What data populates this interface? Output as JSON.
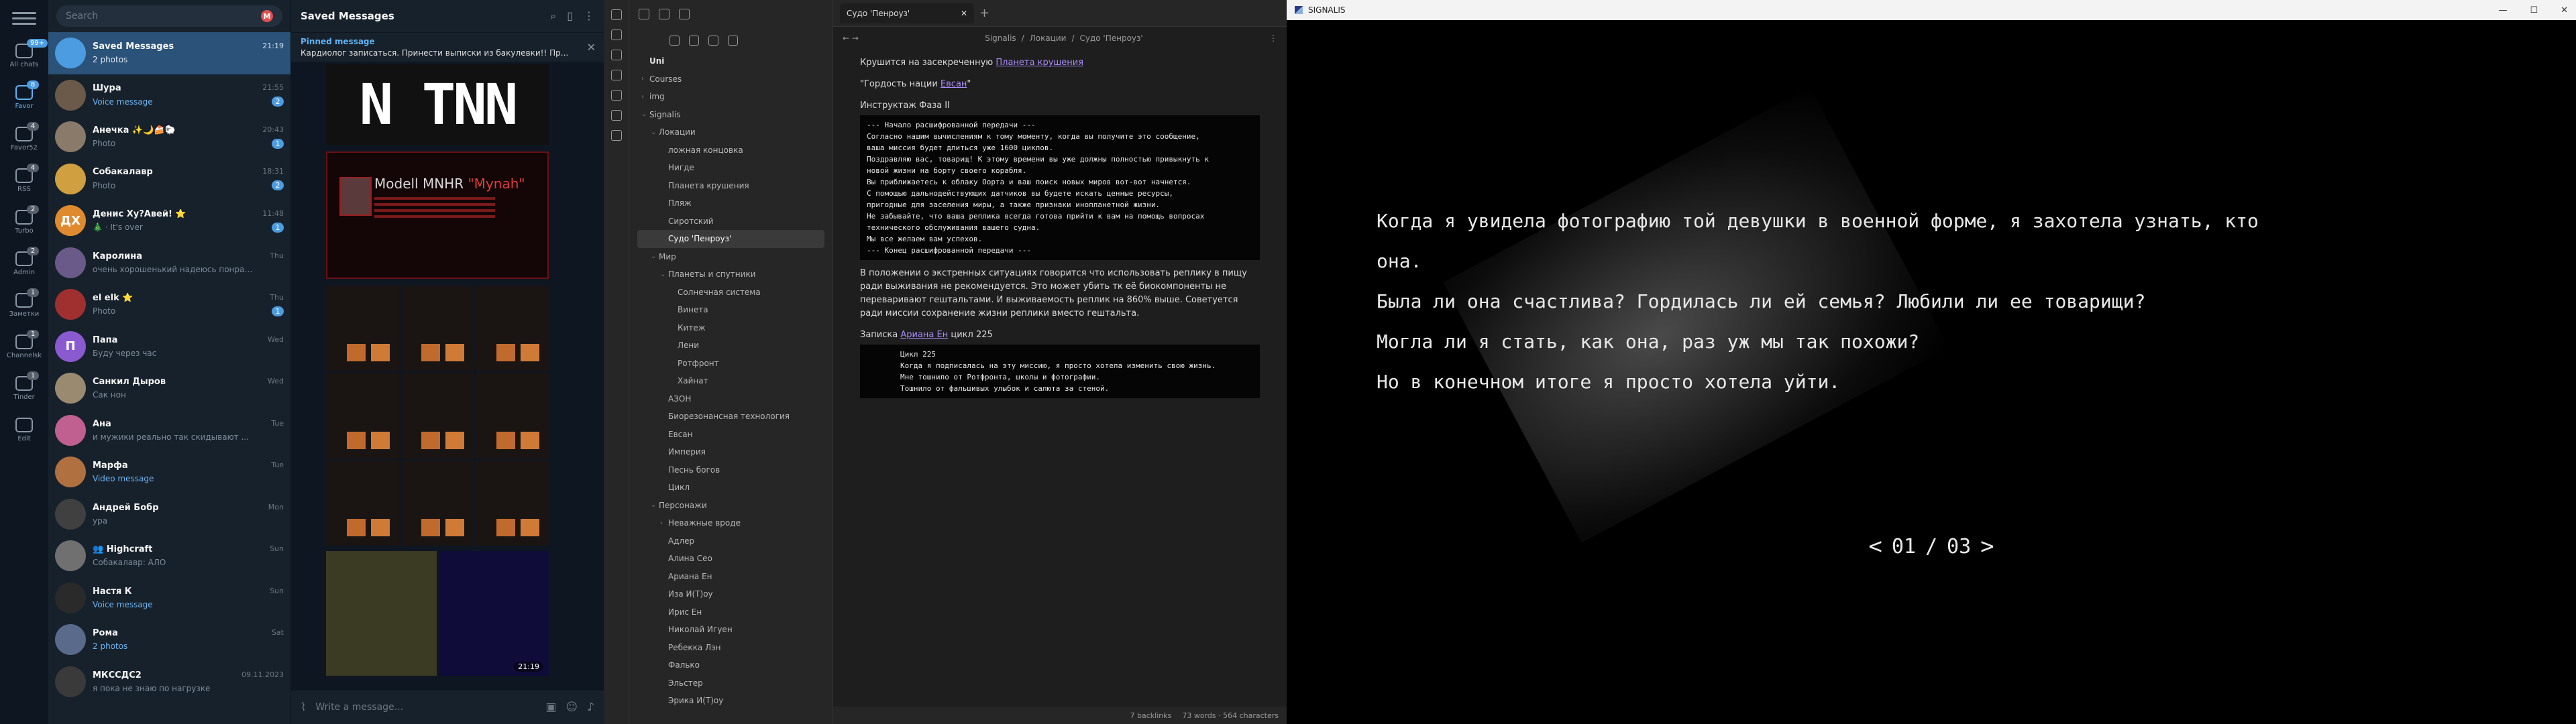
{
  "telegram": {
    "folders": [
      {
        "name": "All chats",
        "badge": "99+",
        "active": false,
        "muted": false
      },
      {
        "name": "Favor",
        "badge": "8",
        "active": true,
        "muted": false
      },
      {
        "name": "Favor52",
        "badge": "4",
        "active": false,
        "muted": true
      },
      {
        "name": "RSS",
        "badge": "4",
        "active": false,
        "muted": true
      },
      {
        "name": "Turbo",
        "badge": "2",
        "active": false,
        "muted": true
      },
      {
        "name": "Admin",
        "badge": "2",
        "active": false,
        "muted": true
      },
      {
        "name": "Заметки",
        "badge": "1",
        "active": false,
        "muted": true
      },
      {
        "name": "Channelsk",
        "badge": "1",
        "active": false,
        "muted": true
      },
      {
        "name": "Tinder",
        "badge": "1",
        "active": false,
        "muted": true
      },
      {
        "name": "Edit",
        "badge": "",
        "active": false,
        "muted": false
      }
    ],
    "search_placeholder": "Search",
    "chats": [
      {
        "name": "Saved Messages",
        "time": "21:19",
        "msg": "2 photos",
        "badge": "",
        "color": "#4c9ce2",
        "initials": "",
        "active": true,
        "hl": false
      },
      {
        "name": "Шура",
        "time": "21:55",
        "msg": "Voice message",
        "badge": "2",
        "color": "#6b5a4a",
        "initials": "",
        "active": false,
        "hl": true
      },
      {
        "name": "Анечка ✨🌙🍰🐑",
        "time": "20:43",
        "msg": "Photo",
        "badge": "1",
        "color": "#8a7a6a",
        "initials": "",
        "active": false,
        "hl": false
      },
      {
        "name": "Собакалавр",
        "time": "18:31",
        "msg": "Photo",
        "badge": "2",
        "color": "#d0a040",
        "initials": "",
        "active": false,
        "hl": false
      },
      {
        "name": "Денис Ху?Авей! ⭐",
        "time": "11:48",
        "msg": "🎄 · It's over",
        "badge": "1",
        "color": "#e08a30",
        "initials": "ДХ",
        "active": false,
        "hl": false
      },
      {
        "name": "Каролина",
        "time": "Thu",
        "msg": "очень хорошенький надеюсь понрави...",
        "badge": "",
        "color": "#6a5a8a",
        "initials": "",
        "active": false,
        "hl": false
      },
      {
        "name": "el elk ⭐",
        "time": "Thu",
        "msg": "Photo",
        "badge": "1",
        "color": "#a03030",
        "initials": "",
        "active": false,
        "hl": false
      },
      {
        "name": "Папа",
        "time": "Wed",
        "msg": "Буду через час",
        "badge": "",
        "color": "#8a5ad0",
        "initials": "П",
        "active": false,
        "hl": false
      },
      {
        "name": "Санкил Дыров",
        "time": "Wed",
        "msg": "Сак нон",
        "badge": "",
        "color": "#9a8a70",
        "initials": "",
        "active": false,
        "hl": false
      },
      {
        "name": "Ана",
        "time": "Tue",
        "msg": "и мужики реально так скидывают ...",
        "badge": "",
        "color": "#c06090",
        "initials": "",
        "active": false,
        "hl": false
      },
      {
        "name": "Марфа",
        "time": "Tue",
        "msg": "Video message",
        "badge": "",
        "color": "#b07040",
        "initials": "",
        "active": false,
        "hl": true
      },
      {
        "name": "Андрей Бобр",
        "time": "Mon",
        "msg": "ура",
        "badge": "",
        "color": "#404040",
        "initials": "",
        "active": false,
        "hl": false
      },
      {
        "name": "👥 Highcraft",
        "time": "Sun",
        "msg": "Собакалавр: АЛО",
        "badge": "",
        "color": "#707070",
        "initials": "",
        "active": false,
        "hl": false
      },
      {
        "name": "Настя К",
        "time": "Sun",
        "msg": "Voice message",
        "badge": "",
        "color": "#2a2a2a",
        "initials": "",
        "active": false,
        "hl": true
      },
      {
        "name": "Рома",
        "time": "Sat",
        "msg": "2 photos",
        "badge": "",
        "color": "#5a6a8a",
        "initials": "",
        "active": false,
        "hl": true
      },
      {
        "name": "МКССДС2",
        "time": "09.11.2023",
        "msg": "я пока не знаю по нагрузке",
        "badge": "",
        "color": "#3a3a3a",
        "initials": "",
        "active": false,
        "hl": false
      }
    ],
    "chat_title": "Saved Messages",
    "pinned_label": "Pinned message",
    "pinned_text": "Кардиолог записаться. Принести выписки из бакулевки!! Пр...",
    "media_big": "N TNN",
    "media_poster_title": "Modell MNHR",
    "media_poster_quote": "\"Mynah\"",
    "media_time": "21:19",
    "composer_placeholder": "Write a message..."
  },
  "obsidian": {
    "tab_title": "Судо 'Пенроуз'",
    "crumbs": [
      "Signalis",
      "Локации",
      "Судо 'Пенроуз'"
    ],
    "tree": [
      {
        "label": "Uni",
        "depth": 0,
        "chev": "",
        "root": true,
        "sel": false
      },
      {
        "label": "Courses",
        "depth": 0,
        "chev": "›",
        "root": false,
        "sel": false
      },
      {
        "label": "img",
        "depth": 0,
        "chev": "›",
        "root": false,
        "sel": false
      },
      {
        "label": "Signalis",
        "depth": 0,
        "chev": "⌄",
        "root": false,
        "sel": false
      },
      {
        "label": "Локации",
        "depth": 1,
        "chev": "⌄",
        "root": false,
        "sel": false
      },
      {
        "label": "ложная концовка",
        "depth": 2,
        "chev": "",
        "root": false,
        "sel": false
      },
      {
        "label": "Нигде",
        "depth": 2,
        "chev": "",
        "root": false,
        "sel": false
      },
      {
        "label": "Планета крушения",
        "depth": 2,
        "chev": "",
        "root": false,
        "sel": false
      },
      {
        "label": "Пляж",
        "depth": 2,
        "chev": "",
        "root": false,
        "sel": false
      },
      {
        "label": "Сиротский",
        "depth": 2,
        "chev": "",
        "root": false,
        "sel": false
      },
      {
        "label": "Судо 'Пенроуз'",
        "depth": 2,
        "chev": "",
        "root": false,
        "sel": true
      },
      {
        "label": "Мир",
        "depth": 1,
        "chev": "⌄",
        "root": false,
        "sel": false
      },
      {
        "label": "Планеты и спутники",
        "depth": 2,
        "chev": "⌄",
        "root": false,
        "sel": false
      },
      {
        "label": "Солнечная система",
        "depth": 3,
        "chev": "",
        "root": false,
        "sel": false
      },
      {
        "label": "Винета",
        "depth": 3,
        "chev": "",
        "root": false,
        "sel": false
      },
      {
        "label": "Китеж",
        "depth": 3,
        "chev": "",
        "root": false,
        "sel": false
      },
      {
        "label": "Лени",
        "depth": 3,
        "chev": "",
        "root": false,
        "sel": false
      },
      {
        "label": "Ротфронт",
        "depth": 3,
        "chev": "",
        "root": false,
        "sel": false
      },
      {
        "label": "Хайнат",
        "depth": 3,
        "chev": "",
        "root": false,
        "sel": false
      },
      {
        "label": "АЗОН",
        "depth": 2,
        "chev": "",
        "root": false,
        "sel": false
      },
      {
        "label": "Биорезонансная технология",
        "depth": 2,
        "chev": "",
        "root": false,
        "sel": false
      },
      {
        "label": "Евсан",
        "depth": 2,
        "chev": "",
        "root": false,
        "sel": false
      },
      {
        "label": "Империя",
        "depth": 2,
        "chev": "",
        "root": false,
        "sel": false
      },
      {
        "label": "Песнь богов",
        "depth": 2,
        "chev": "",
        "root": false,
        "sel": false
      },
      {
        "label": "Цикл",
        "depth": 2,
        "chev": "",
        "root": false,
        "sel": false
      },
      {
        "label": "Персонажи",
        "depth": 1,
        "chev": "⌄",
        "root": false,
        "sel": false
      },
      {
        "label": "Неважные вроде",
        "depth": 2,
        "chev": "›",
        "root": false,
        "sel": false
      },
      {
        "label": "Адлер",
        "depth": 2,
        "chev": "",
        "root": false,
        "sel": false
      },
      {
        "label": "Алина Сео",
        "depth": 2,
        "chev": "",
        "root": false,
        "sel": false
      },
      {
        "label": "Ариана Ен",
        "depth": 2,
        "chev": "",
        "root": false,
        "sel": false
      },
      {
        "label": "Изa И(Т)оу",
        "depth": 2,
        "chev": "",
        "root": false,
        "sel": false
      },
      {
        "label": "Ирис Ен",
        "depth": 2,
        "chev": "",
        "root": false,
        "sel": false
      },
      {
        "label": "Николай Игуен",
        "depth": 2,
        "chev": "",
        "root": false,
        "sel": false
      },
      {
        "label": "Ребекка Лэн",
        "depth": 2,
        "chev": "",
        "root": false,
        "sel": false
      },
      {
        "label": "Фалько",
        "depth": 2,
        "chev": "",
        "root": false,
        "sel": false
      },
      {
        "label": "Эльстер",
        "depth": 2,
        "chev": "",
        "root": false,
        "sel": false
      },
      {
        "label": "Эрика И(Т)оу",
        "depth": 2,
        "chev": "",
        "root": false,
        "sel": false
      }
    ],
    "note": {
      "p1_pre": "Крушится на засекреченную ",
      "p1_link": "Планета крушения",
      "p2_pre": "\"Гордость нации ",
      "p2_link": "Евсан",
      "p2_post": "\"",
      "p3": "Инструктаж Фаза II",
      "term1": [
        "--- Начало расшифрованной передачи ---",
        "Согласно нашим вычислениям к тому моменту, когда вы получите это сообщение,",
        "ваша миссия будет длиться уже 1600 циклов.",
        "Поздравляю вас, товарищ! К этому времени вы уже должны полностью привыкнуть к",
        "новой жизни на борту своего корабля.",
        "Вы приближаетесь к облаку Oopта и ваш поиск новых миров вот-вот начнется.",
        "С помощью дальнодействующих датчиков вы будете искать ценные ресурсы,",
        "пригодные для заселения миры, а также признаки инопланетной жизни.",
        "Не забывайте, что ваша реплика всегда готова прийти к вам на помощь вопросах",
        "технического обслуживания вашего судна.",
        "Мы все желаем вам успехов.",
        "--- Конец расшифрованной передачи ---"
      ],
      "p4": "В положении о экстренных ситуациях говорится что использовать реплику в пищу ради выживания не рекомендуется. Это может убить тк её биокомпоненты не переваривают гештальтами. И выживаемость реплик на 860% выше. Советуется ради миссии сохранение жизни реплики вместо гештальта.",
      "p5_pre": "Записка ",
      "p5_link": "Ариана Ен",
      "p5_post": " цикл 225",
      "term2": [
        "Цикл 225",
        "Когда я подписалась на эту миссию, я просто хотела изменить свою жизнь.",
        "Мне тошнило от Ротфронта, школы и фотографии.",
        "Тошнило от фальшивых улыбок и салюта за стеной."
      ]
    },
    "status_backlinks": "7 backlinks",
    "status_words": "73 words · 564 characters"
  },
  "signalis": {
    "window_title": "SIGNALIS",
    "dialogue": [
      "Когда я увидела фотографию той девушки в военной форме, я захотела узнать, кто",
      "она.",
      "Была ли она счастлива? Гордилась ли ей семья? Любили ли ее товарищи?",
      "Могла ли я стать, как она, раз уж мы так похожи?",
      "Но в конечном итоге я просто хотела уйти."
    ],
    "page_current": "01",
    "page_sep": "/",
    "page_total": "03",
    "prev_glyph": "<",
    "next_glyph": ">"
  }
}
